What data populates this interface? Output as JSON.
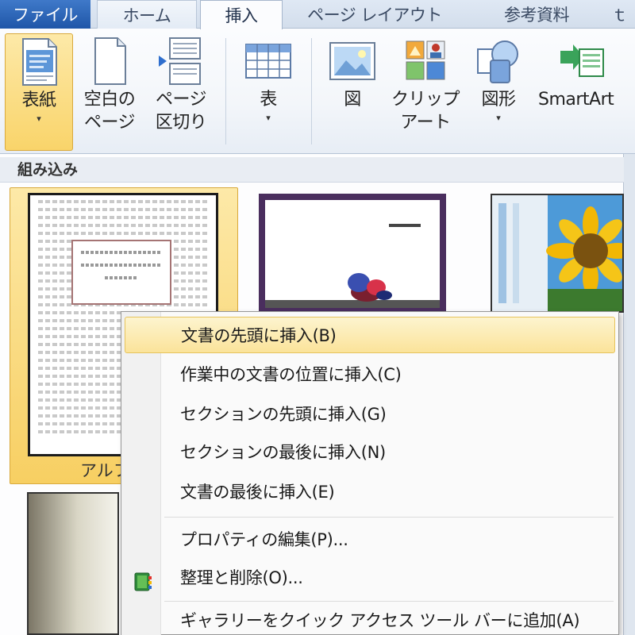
{
  "tabs": [
    {
      "label": "ファイル"
    },
    {
      "label": "ホーム"
    },
    {
      "label": "挿入"
    },
    {
      "label": "ページ レイアウト"
    },
    {
      "label": "参考資料"
    },
    {
      "label": "ｔ"
    }
  ],
  "ribbon": {
    "buttons": [
      {
        "label1": "表紙",
        "label2": "▾"
      },
      {
        "label1": "空白の",
        "label2": "ページ"
      },
      {
        "label1": "ページ",
        "label2": "区切り"
      },
      {
        "label1": "表",
        "label2": "▾"
      },
      {
        "label1": "図",
        "label2": ""
      },
      {
        "label1": "クリップ",
        "label2": "アート"
      },
      {
        "label1": "図形",
        "label2": "▾"
      },
      {
        "label1": "SmartArt",
        "label2": ""
      }
    ]
  },
  "gallery": {
    "section_title": "組み込み",
    "first_item_label": "アルファ"
  },
  "menu": {
    "items": [
      {
        "label": "文書の先頭に挿入(B)",
        "highlighted": true
      },
      {
        "label": "作業中の文書の位置に挿入(C)"
      },
      {
        "label": "セクションの先頭に挿入(G)"
      },
      {
        "label": "セクションの最後に挿入(N)"
      },
      {
        "label": "文書の最後に挿入(E)"
      },
      {
        "label": "プロパティの編集(P)..."
      },
      {
        "label": "整理と削除(O)...",
        "icon": "organizer-icon"
      },
      {
        "label": "ギャラリーをクイック アクセス ツール バーに追加(A)"
      }
    ]
  },
  "colors": {
    "file_tab": "#2a62b5",
    "highlight": "#fbe39a",
    "ribbon_bg": "#f3f6fa"
  }
}
